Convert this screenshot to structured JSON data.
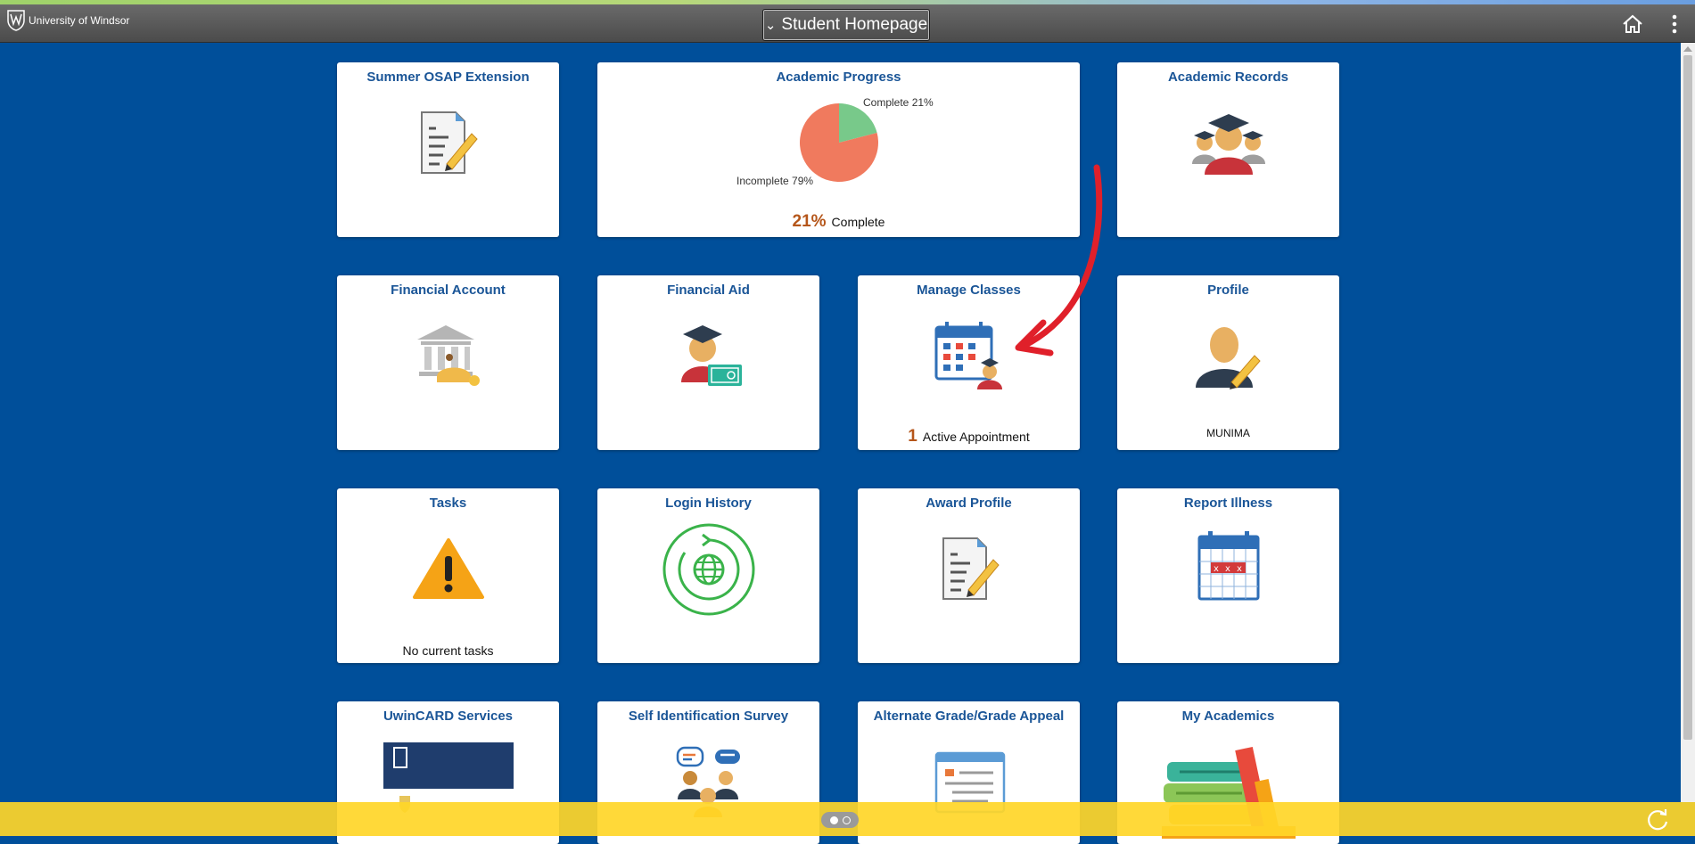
{
  "header": {
    "brand_text": "University of Windsor",
    "page_title": "Student Homepage",
    "home_icon": "home-icon",
    "menu_icon": "kebab-menu-icon"
  },
  "tiles": {
    "summer_osap": {
      "title": "Summer OSAP Extension",
      "icon": "document-edit-icon"
    },
    "academic_progress": {
      "title": "Academic Progress",
      "complete_label": "Complete 21%",
      "incomplete_label": "Incomplete 79%",
      "percent": "21%",
      "percent_label": "Complete"
    },
    "academic_records": {
      "title": "Academic Records",
      "icon": "graduates-icon"
    },
    "financial_account": {
      "title": "Financial Account",
      "icon": "bank-icon"
    },
    "financial_aid": {
      "title": "Financial Aid",
      "icon": "graduate-card-icon"
    },
    "manage_classes": {
      "title": "Manage Classes",
      "count": "1",
      "count_label": "Active Appointment",
      "icon": "calendar-graduate-icon"
    },
    "profile": {
      "title": "Profile",
      "username": "MUNIMA",
      "icon": "profile-edit-icon"
    },
    "tasks": {
      "title": "Tasks",
      "status": "No current tasks",
      "icon": "warning-icon"
    },
    "login_history": {
      "title": "Login History",
      "icon": "globe-history-icon"
    },
    "award_profile": {
      "title": "Award Profile",
      "icon": "document-edit-icon"
    },
    "report_illness": {
      "title": "Report Illness",
      "icon": "calendar-x-icon"
    },
    "uwincard": {
      "title": "UwinCARD Services",
      "icon": "id-card-icon"
    },
    "self_id_survey": {
      "title": "Self Identification Survey",
      "icon": "people-chat-icon"
    },
    "grade_appeal": {
      "title": "Alternate Grade/Grade Appeal",
      "icon": "form-window-icon"
    },
    "my_academics": {
      "title": "My Academics",
      "icon": "books-icon"
    }
  },
  "chart_data": {
    "type": "pie",
    "categories": [
      "Complete",
      "Incomplete"
    ],
    "values": [
      21,
      79
    ],
    "colors": [
      "#78c98a",
      "#f07a5e"
    ]
  },
  "footer": {
    "pager_count": 2,
    "active_page": 1
  }
}
